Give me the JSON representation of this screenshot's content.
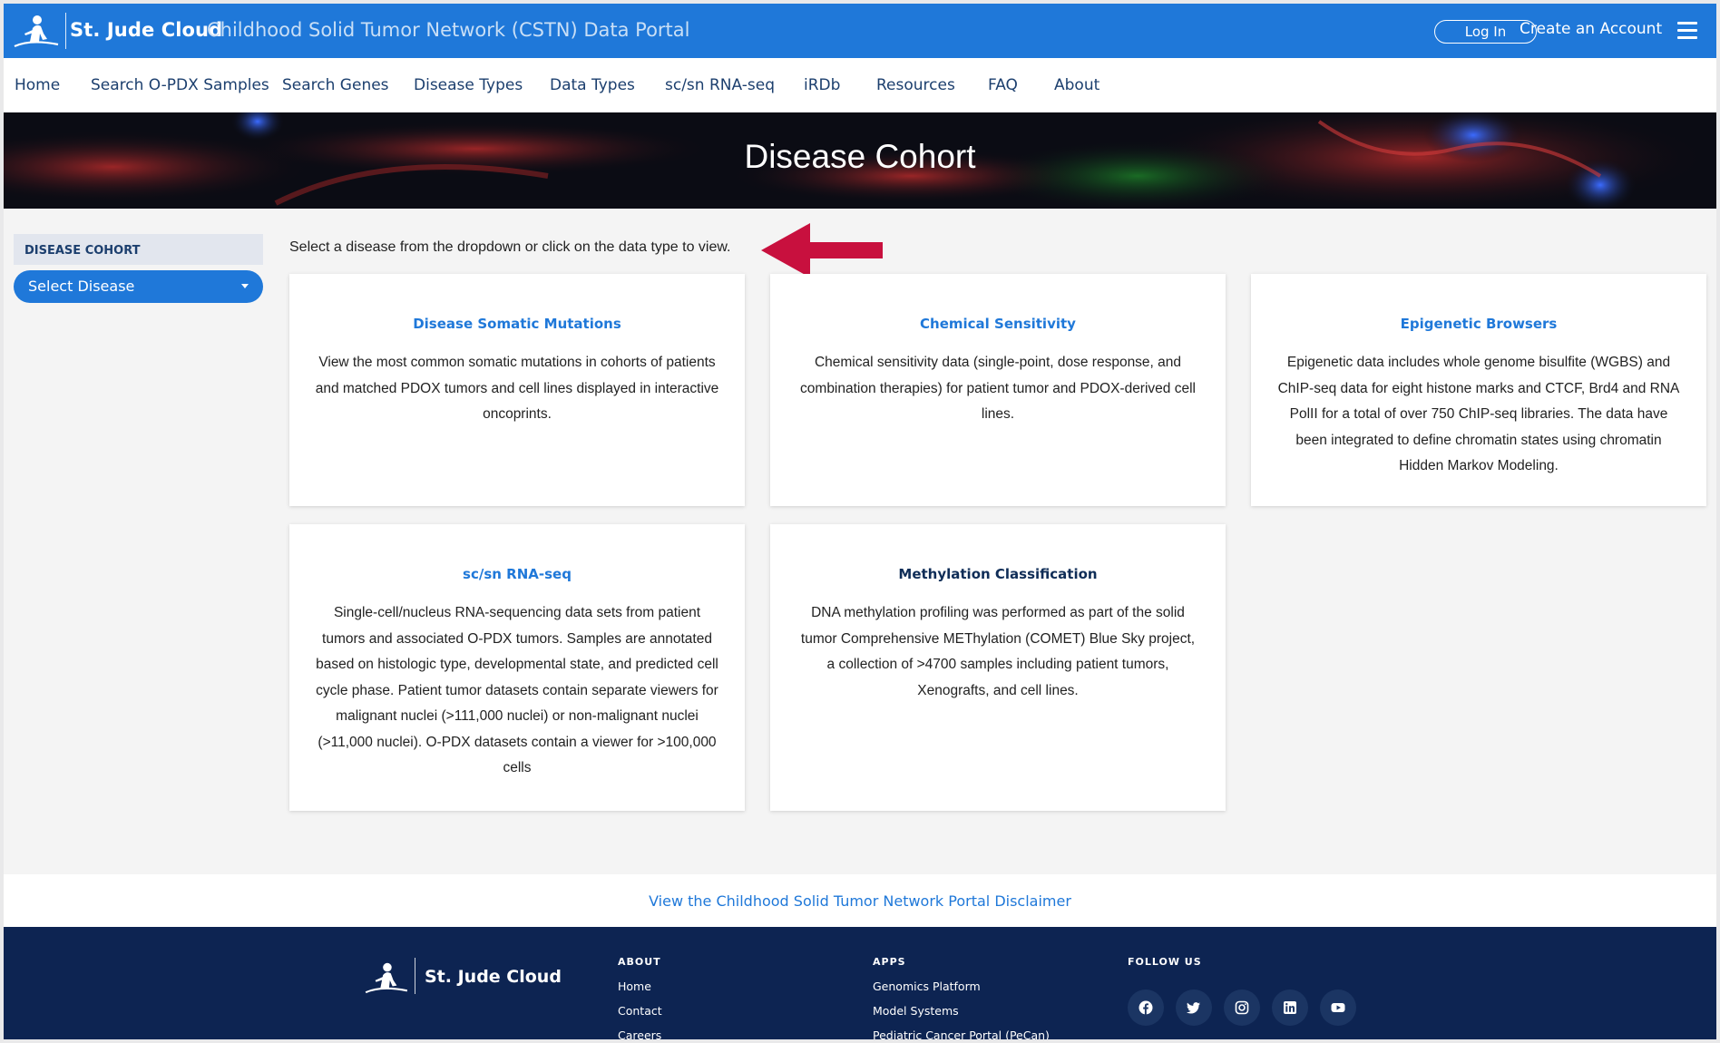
{
  "header": {
    "brand": "St. Jude Cloud",
    "portal_title": "Childhood Solid Tumor Network (CSTN) Data Portal",
    "login_label": "Log In",
    "create_account_label": "Create an Account"
  },
  "nav": {
    "items": [
      {
        "label": "Home"
      },
      {
        "label": "Search O-PDX Samples"
      },
      {
        "label": "Search Genes"
      },
      {
        "label": "Disease Types"
      },
      {
        "label": "Data Types"
      },
      {
        "label": "sc/sn RNA-seq"
      },
      {
        "label": "iRDb"
      },
      {
        "label": "Resources"
      },
      {
        "label": "FAQ"
      },
      {
        "label": "About"
      }
    ]
  },
  "hero": {
    "title": "Disease Cohort"
  },
  "sidebar": {
    "header": "DISEASE COHORT",
    "select_label": "Select Disease"
  },
  "main": {
    "instruction": "Select a disease from the dropdown or click on the data type to view.",
    "cards": [
      {
        "title": "Disease Somatic Mutations",
        "body": "View the most common somatic mutations in cohorts of patients and matched PDOX tumors and cell lines displayed in interactive oncoprints."
      },
      {
        "title": "Chemical Sensitivity",
        "body": "Chemical sensitivity data (single-point, dose response, and combination therapies) for patient tumor and PDOX-derived cell lines."
      },
      {
        "title": "Epigenetic Browsers",
        "body": "Epigenetic data includes whole genome bisulfite (WGBS) and ChIP-seq data for eight histone marks and CTCF, Brd4 and RNA PolII for a total of over 750 ChIP-seq libraries. The data have been integrated to define chromatin states using chromatin Hidden Markov Modeling."
      },
      {
        "title": "sc/sn RNA-seq",
        "body": "Single-cell/nucleus RNA-sequencing data sets from patient tumors and associated O-PDX tumors. Samples are annotated based on histologic type, developmental state, and predicted cell cycle phase. Patient tumor datasets contain separate viewers for malignant nuclei (>111,000 nuclei) or non-malignant nuclei (>11,000 nuclei). O-PDX datasets contain a viewer for >100,000 cells"
      },
      {
        "title": "Methylation Classification",
        "body": "DNA methylation profiling was performed as part of the solid tumor Comprehensive METhylation (COMET) Blue Sky project, a collection of >4700 samples including patient tumors, Xenografts, and cell lines."
      }
    ]
  },
  "disclaimer": {
    "label": "View the Childhood Solid Tumor Network Portal Disclaimer"
  },
  "footer": {
    "brand": "St. Jude Cloud",
    "about": {
      "title": "ABOUT",
      "links": [
        "Home",
        "Contact",
        "Careers"
      ]
    },
    "apps": {
      "title": "APPS",
      "links": [
        "Genomics Platform",
        "Model Systems",
        "Pediatric Cancer Portal (PeCan)"
      ]
    },
    "follow": {
      "title": "FOLLOW US",
      "icons": [
        "facebook-icon",
        "twitter-icon",
        "instagram-icon",
        "linkedin-icon",
        "youtube-icon"
      ]
    }
  },
  "colors": {
    "brand_blue": "#1f78d9",
    "navy": "#0d2452",
    "nav_text": "#1c3f6e",
    "arrow_red": "#c8103e"
  }
}
